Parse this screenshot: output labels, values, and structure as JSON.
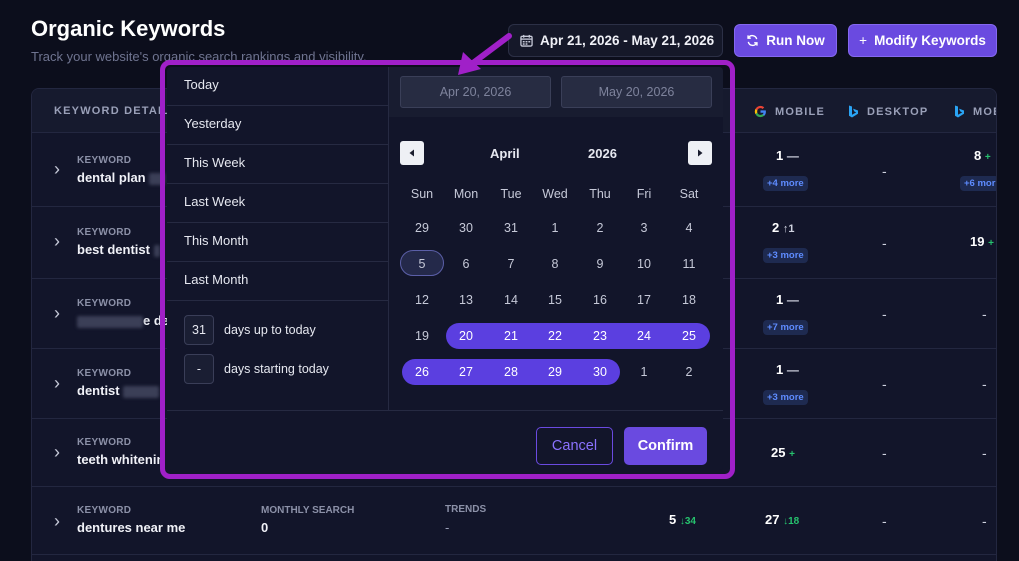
{
  "header": {
    "title": "Organic Keywords",
    "subtitle": "Track your website's organic search rankings and visibility.",
    "date_range": "Apr 21, 2026 - May 21, 2026",
    "run_now": "Run Now",
    "modify_plus": "+",
    "modify_keywords": "Modify Keywords"
  },
  "table": {
    "columns": {
      "keyword_detail": "KEYWORD DETAIL",
      "google_mobile": "MOBILE",
      "bing_desktop": "DESKTOP",
      "bing_mobile": "MOB"
    },
    "rows": [
      {
        "label": "KEYWORD",
        "keyword": "dental plan",
        "mobile_rank": "1",
        "mobile_delta": "—",
        "mobile_more": "+4 more",
        "bing_desktop": "-",
        "bing_mobile_rank": "8",
        "bing_mobile_delta": "+",
        "bing_mobile_more": "+6 mor"
      },
      {
        "label": "KEYWORD",
        "keyword": "best dentist",
        "mobile_rank": "2",
        "mobile_delta": "↑1",
        "mobile_more": "+3 more",
        "bing_desktop": "-",
        "bing_mobile_rank": "19",
        "bing_mobile_delta": "+"
      },
      {
        "label": "KEYWORD",
        "keyword_suffix": "e de",
        "mobile_rank": "1",
        "mobile_delta": "—",
        "mobile_more": "+7 more",
        "bing_desktop": "-",
        "bing_mobile_dash": "-"
      },
      {
        "label": "KEYWORD",
        "keyword": "dentist",
        "mobile_rank": "1",
        "mobile_delta": "—",
        "mobile_more": "+3 more",
        "bing_desktop": "-",
        "bing_mobile_dash": "-"
      },
      {
        "label": "KEYWORD",
        "keyword": "teeth whitenin",
        "mobile_rank": "25",
        "mobile_delta": "+",
        "bing_desktop": "-",
        "bing_mobile_dash": "-"
      },
      {
        "label": "KEYWORD",
        "keyword": "dentures near me",
        "monthly_search_label": "MONTHLY SEARCH",
        "monthly_search": "0",
        "trends_label": "TRENDS",
        "trends": "-",
        "google_desktop_rank": "5",
        "google_desktop_delta": "↓34",
        "mobile_rank": "27",
        "mobile_delta": "↓18",
        "bing_desktop": "-",
        "bing_mobile_dash": "-"
      }
    ]
  },
  "picker": {
    "presets": [
      "Today",
      "Yesterday",
      "This Week",
      "Last Week",
      "This Month",
      "Last Month"
    ],
    "days_up_value": "31",
    "days_up_label": "days up to today",
    "days_start_value": "-",
    "days_start_label": "days starting today",
    "start_date": "Apr 20, 2026",
    "end_date": "May 20, 2026",
    "month": "April",
    "year": "2026",
    "weekdays": [
      "Sun",
      "Mon",
      "Tue",
      "Wed",
      "Thu",
      "Fri",
      "Sat"
    ],
    "weeks": [
      [
        "29",
        "30",
        "31",
        "1",
        "2",
        "3",
        "4"
      ],
      [
        "5",
        "6",
        "7",
        "8",
        "9",
        "10",
        "11"
      ],
      [
        "12",
        "13",
        "14",
        "15",
        "16",
        "17",
        "18"
      ],
      [
        "19",
        "20",
        "21",
        "22",
        "23",
        "24",
        "25"
      ],
      [
        "26",
        "27",
        "28",
        "29",
        "30",
        "1",
        "2"
      ]
    ],
    "cancel": "Cancel",
    "confirm": "Confirm"
  },
  "colors": {
    "accent": "#6a4ae0",
    "range": "#5b3fe0",
    "annotation": "#a020c8",
    "up": "#26c26e",
    "link": "#5e8cff"
  }
}
